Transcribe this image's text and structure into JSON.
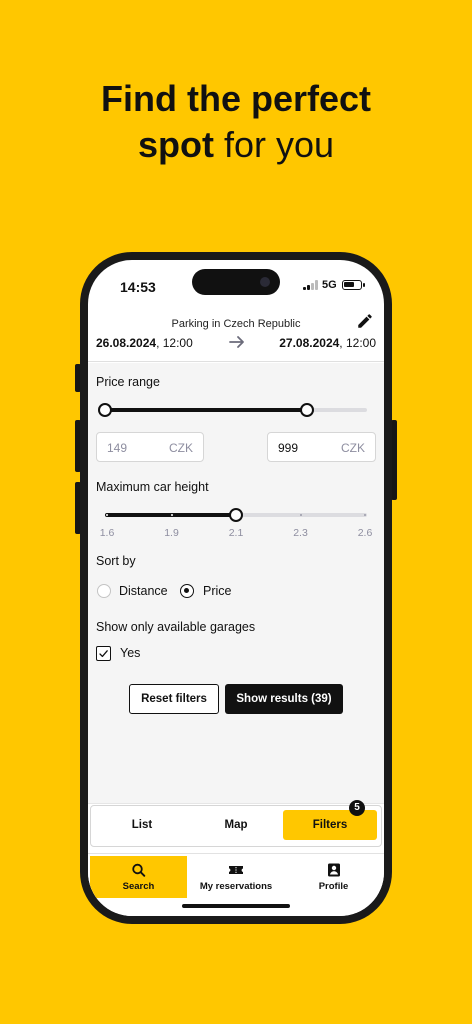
{
  "promo": {
    "line1": "Find the perfect",
    "line2_bold": "spot",
    "line2_rest": " for you"
  },
  "status_bar": {
    "time": "14:53",
    "network": "5G",
    "battery_level": 0.7
  },
  "header": {
    "subtitle": "Parking in Czech Republic",
    "from_date": "26.08.2024",
    "from_time": ", 12:00",
    "to_date": "27.08.2024",
    "to_time": ", 12:00",
    "edit_icon": "pencil-icon",
    "arrow_icon": "arrow-right-icon"
  },
  "filters": {
    "price_range": {
      "label": "Price range",
      "min_value": "149",
      "max_value": "999",
      "unit": "CZK",
      "low_fraction": 0.0,
      "high_fraction": 0.77
    },
    "car_height": {
      "label": "Maximum car height",
      "ticks": [
        "1.6",
        "1.9",
        "2.1",
        "2.3",
        "2.6"
      ],
      "selected": "2.1",
      "selected_fraction": 0.5
    },
    "sort": {
      "label": "Sort by",
      "options": [
        "Distance",
        "Price"
      ],
      "selected": "Price"
    },
    "availability": {
      "label": "Show only available garages",
      "option": "Yes",
      "checked": true
    },
    "reset_label": "Reset filters",
    "show_label": "Show results (39)"
  },
  "segments": {
    "items": [
      "List",
      "Map",
      "Filters"
    ],
    "active": "Filters",
    "badge": "5"
  },
  "tabbar": {
    "items": [
      {
        "label": "Search",
        "icon": "search-icon"
      },
      {
        "label": "My reservations",
        "icon": "ticket-icon"
      },
      {
        "label": "Profile",
        "icon": "profile-icon"
      }
    ],
    "active": "Search"
  },
  "colors": {
    "brand": "#FFC700",
    "dark": "#111111",
    "muted": "#8E8EA0"
  }
}
